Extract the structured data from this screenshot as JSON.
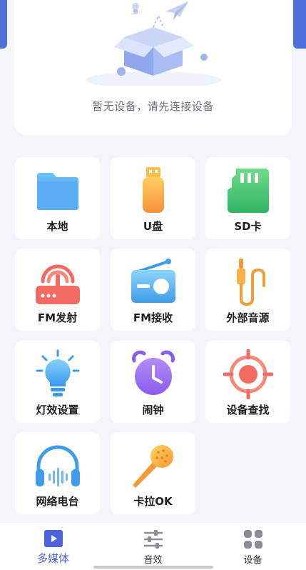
{
  "device_panel": {
    "empty_text": "暂无设备，请先连接设备"
  },
  "grid": {
    "items": [
      {
        "label": "本地",
        "icon": "folder-icon"
      },
      {
        "label": "U盘",
        "icon": "usb-drive-icon"
      },
      {
        "label": "SD卡",
        "icon": "sd-card-icon"
      },
      {
        "label": "FM发射",
        "icon": "router-antenna-icon"
      },
      {
        "label": "FM接收",
        "icon": "radio-icon"
      },
      {
        "label": "外部音源",
        "icon": "audio-cable-icon"
      },
      {
        "label": "灯效设置",
        "icon": "light-bulb-icon"
      },
      {
        "label": "闹钟",
        "icon": "alarm-clock-icon"
      },
      {
        "label": "设备查找",
        "icon": "target-icon"
      },
      {
        "label": "网络电台",
        "icon": "headphones-icon"
      },
      {
        "label": "卡拉OK",
        "icon": "microphone-icon"
      }
    ]
  },
  "tabbar": {
    "tabs": [
      {
        "label": "多媒体",
        "icon": "play-square-icon",
        "active": true
      },
      {
        "label": "音效",
        "icon": "equalizer-sliders-icon",
        "active": false
      },
      {
        "label": "设备",
        "icon": "grid-apps-icon",
        "active": false
      }
    ]
  },
  "colors": {
    "accent": "#4a63d8",
    "header_blue": "#4f6fd6",
    "background": "#f3f5f8"
  }
}
